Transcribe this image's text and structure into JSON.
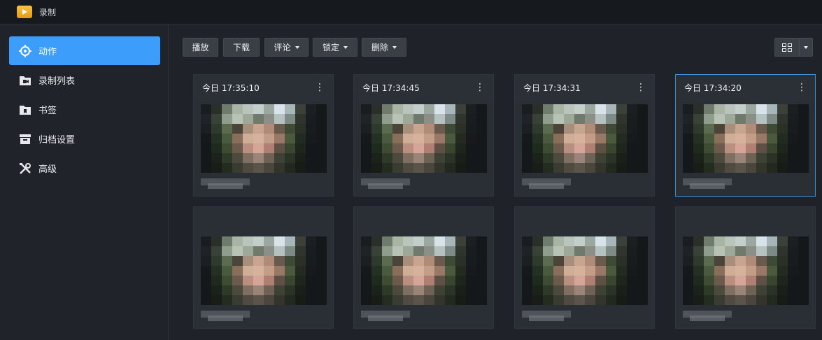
{
  "app": {
    "title": "录制",
    "icon": "video-folder-icon"
  },
  "sidebar": {
    "items": [
      {
        "label": "动作",
        "icon": "crosshair-icon",
        "active": true
      },
      {
        "label": "录制列表",
        "icon": "folder-video-icon",
        "active": false
      },
      {
        "label": "书签",
        "icon": "folder-bookmark-icon",
        "active": false
      },
      {
        "label": "归档设置",
        "icon": "archive-icon",
        "active": false
      },
      {
        "label": "高级",
        "icon": "tools-icon",
        "active": false
      }
    ]
  },
  "toolbar": {
    "play": "播放",
    "download": "下载",
    "comment": "评论",
    "lock": "锁定",
    "delete": "删除",
    "view_icon": "grid-view-icon"
  },
  "cards": [
    {
      "time": "今日 17:35:10",
      "selected": false
    },
    {
      "time": "今日 17:34:45",
      "selected": false
    },
    {
      "time": "今日 17:34:31",
      "selected": false
    },
    {
      "time": "今日 17:34:20",
      "selected": true
    },
    {
      "time": "",
      "selected": false
    },
    {
      "time": "",
      "selected": false
    },
    {
      "time": "",
      "selected": false
    },
    {
      "time": "",
      "selected": false
    }
  ],
  "colors": {
    "accent": "#3d9dfb",
    "background": "#1f2329",
    "card": "#2a2f36",
    "selected_border": "#3d8fd8"
  }
}
